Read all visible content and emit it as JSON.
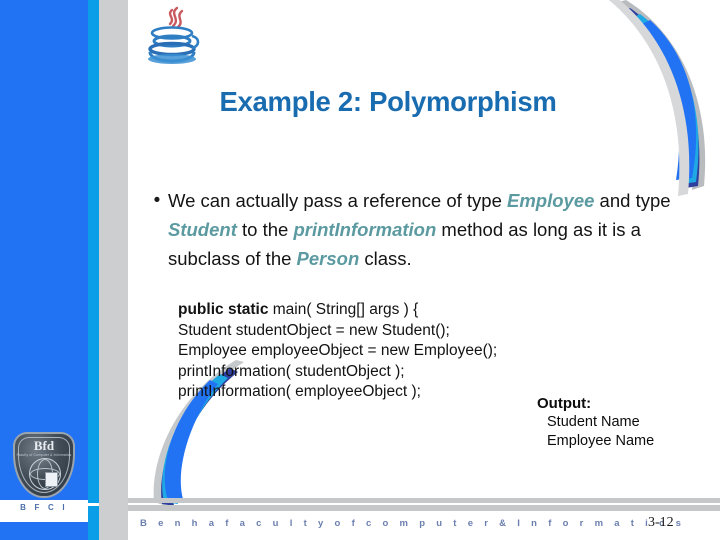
{
  "slide": {
    "title": "Example 2: Polymorphism",
    "page_number": "3-12",
    "title_color": "#1a6cb0",
    "accent_color": "#5b9aa0",
    "sidebar_blue": "#2272f4",
    "sidebar_cyan": "#0a9ee8",
    "sidebar_gray": "#cdcecf"
  },
  "logo": {
    "badge_text": "Bfd",
    "badge_subtext": "Faculty of Computer & Informatics",
    "strip_text": "B F C I",
    "java_icon": "java-coffee-cup-icon"
  },
  "bullet": {
    "marker": "•",
    "seg1": "We can actually pass a reference of type ",
    "kw1": "Employee",
    "seg2": " and type ",
    "kw2": "Student",
    "seg3": " to the ",
    "kw3": "printInformation",
    "seg4": " method as long as it is a subclass of the ",
    "kw4": "Person",
    "seg5": " class."
  },
  "code": {
    "line1_bold": "public static",
    "line1_rest": " main( String[] args ) {",
    "line2": "Student studentObject = new Student();",
    "line3": "Employee employeeObject = new Employee();",
    "line4": "printInformation( studentObject );",
    "line5": "printInformation( employeeObject );"
  },
  "output": {
    "label": "Output:",
    "line1": "Student Name",
    "line2": "Employee Name"
  },
  "footer": {
    "text": "B e n h a     f a c u l t y     o f     c o m p u t e r     &     I n f o r m a t i c s"
  }
}
